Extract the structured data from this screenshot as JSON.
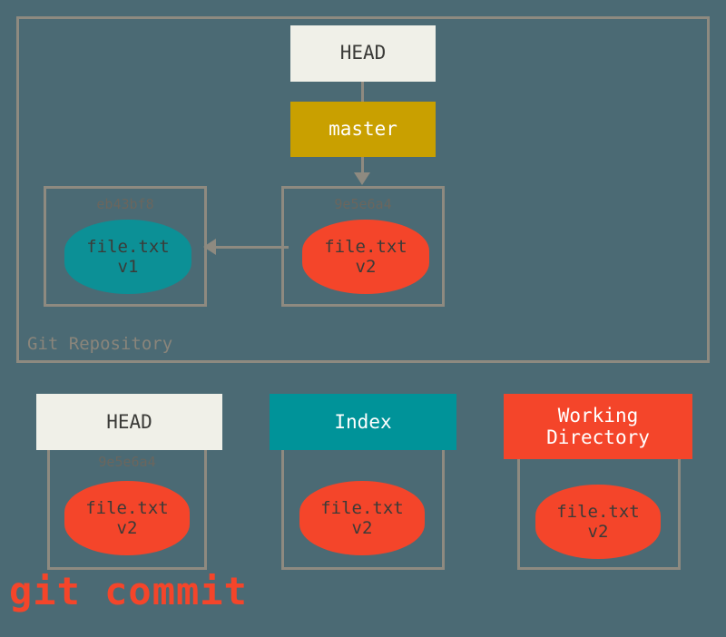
{
  "diagram": {
    "title": "git commit",
    "background_color": "#4b6a74",
    "caption": "git commit"
  },
  "repository": {
    "label": "Git Repository",
    "border_color": "#8e8a80",
    "head_pointer": {
      "label": "HEAD",
      "background": "#f0f0e8"
    },
    "branch_pointer": {
      "label": "master",
      "background": "#c9a000"
    },
    "commits": [
      {
        "hash": "eb43bf8",
        "blob_name": "file.txt",
        "blob_version": "v1",
        "blob_color": "#0c9096"
      },
      {
        "hash": "9e5e6a4",
        "blob_name": "file.txt",
        "blob_version": "v2",
        "blob_color": "#f4452a"
      }
    ]
  },
  "areas": [
    {
      "label": "HEAD",
      "header_color": "#f0f0e8",
      "hash": "9e5e6a4",
      "blob_name": "file.txt",
      "blob_version": "v2"
    },
    {
      "label": "Index",
      "header_color": "#009399",
      "hash": "",
      "blob_name": "file.txt",
      "blob_version": "v2"
    },
    {
      "label_line1": "Working",
      "label_line2": "Directory",
      "header_color": "#f4452a",
      "hash": "",
      "blob_name": "file.txt",
      "blob_version": "v2"
    }
  ]
}
